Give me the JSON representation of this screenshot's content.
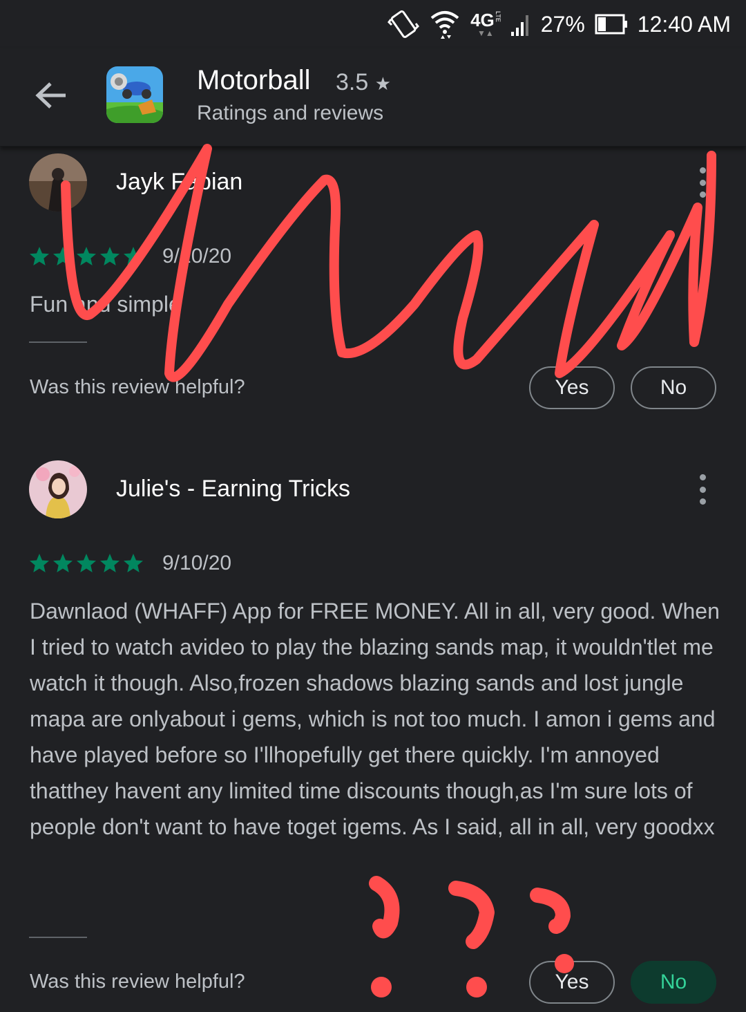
{
  "status_bar": {
    "network": "4G",
    "network_sub": "LTE",
    "battery": "27%",
    "time": "12:40 AM"
  },
  "app_bar": {
    "title": "Motorball",
    "rating": "3.5",
    "rating_star": "★",
    "subtitle": "Ratings and reviews"
  },
  "reviews": [
    {
      "name": "Jayk Fabian",
      "stars": 5,
      "date": "9/10/20",
      "text": "Fun and simple",
      "helpful_prompt": "Was this review helpful?",
      "yes_label": "Yes",
      "no_label": "No"
    },
    {
      "name": "Julie's - Earning Tricks",
      "stars": 5,
      "date": "9/10/20",
      "text": "Dawnlaod (WHAFF) App for FREE MONEY. All in all, very good. When I tried to watch avideo to play the blazing sands map, it wouldn'tlet me watch it though. Also,frozen shadows blazing sands and lost jungle mapa are onlyabout i gems, which is not too much. I amon i gems and have played before so I'llhopefully get there quickly. I'm annoyed thatthey havent any limited time discounts though,as I'm sure lots of people don't want to have toget igems. As I said, all in all, very goodxx",
      "helpful_prompt": "Was this review helpful?",
      "yes_label": "Yes",
      "no_label": "No",
      "selected": "No"
    }
  ],
  "colors": {
    "background": "#202124",
    "star_green": "#01875f",
    "scribble_red": "#ff4d4d",
    "selected_pill_bg": "#0d3b2e",
    "selected_pill_text": "#34d399"
  }
}
